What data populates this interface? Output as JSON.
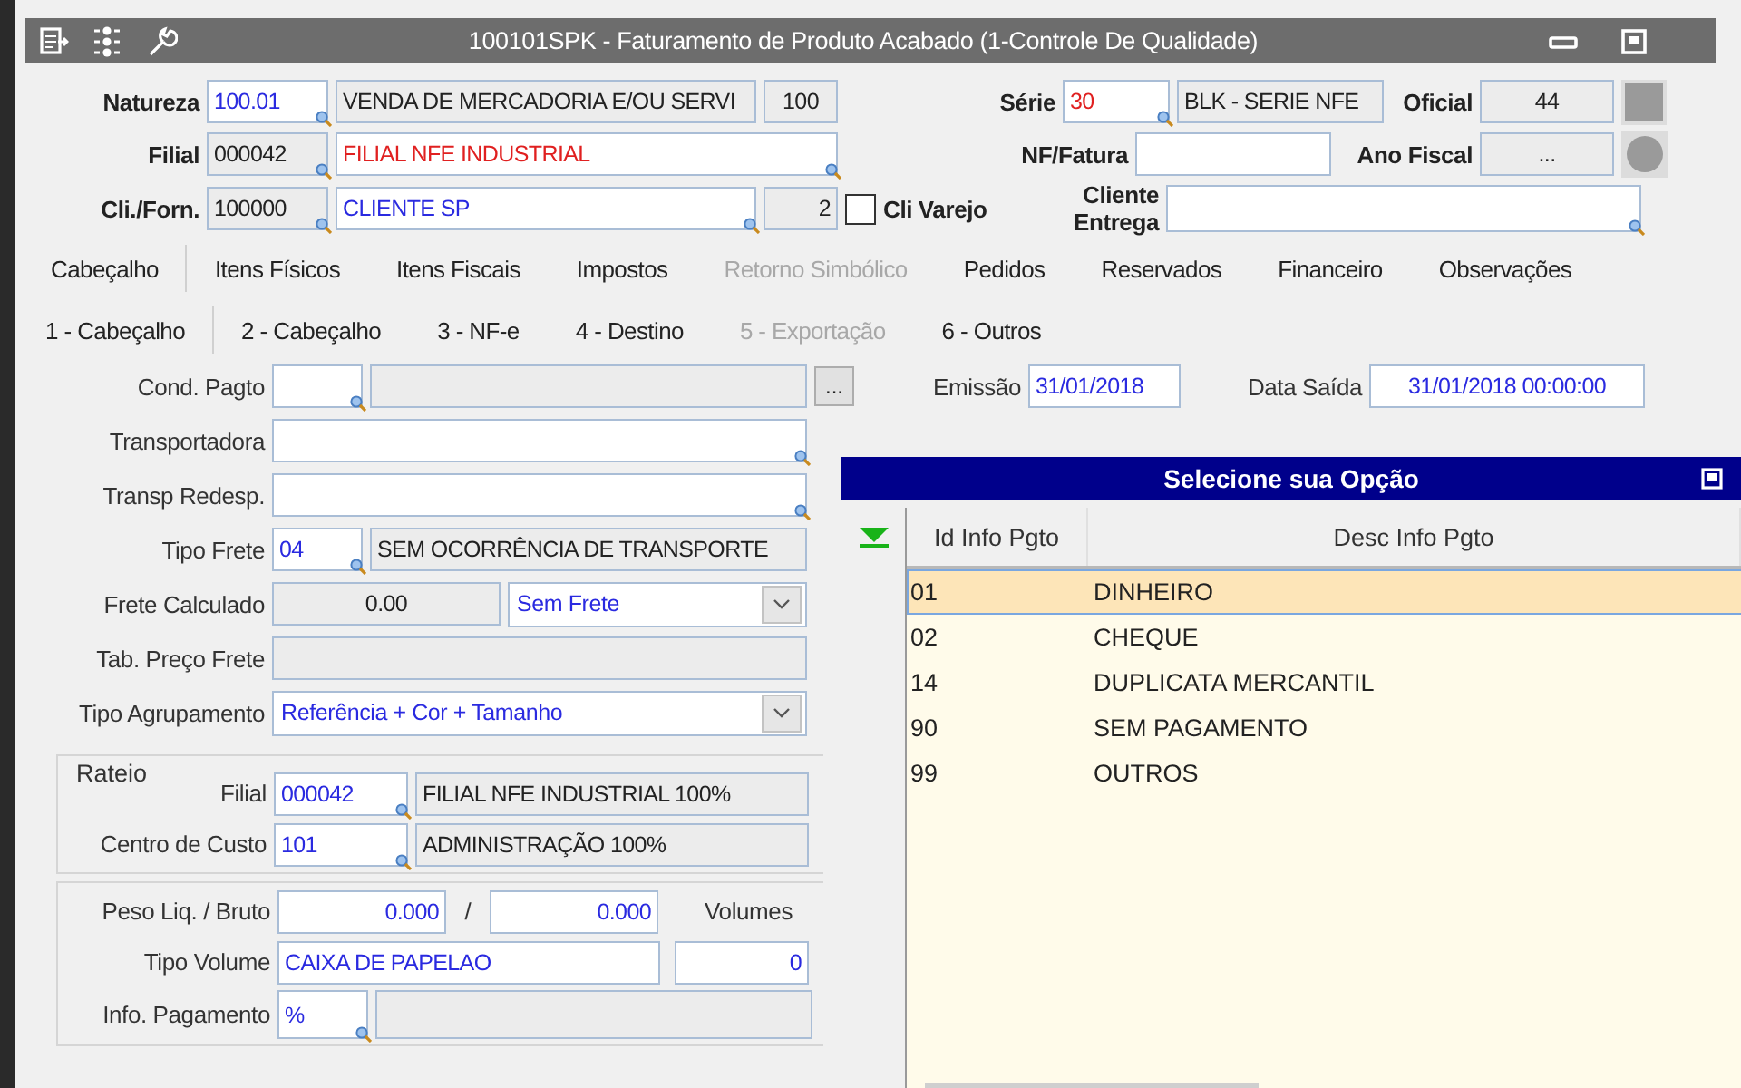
{
  "window": {
    "title": "100101SPK - Faturamento de Produto Acabado (1-Controle De Qualidade)"
  },
  "header": {
    "natureza": {
      "label": "Natureza",
      "code": {
        "value": "100.01",
        "readonly": false,
        "lookup": true
      },
      "description": {
        "value": "VENDA DE MERCADORIA E/OU SERVI",
        "readonly": true,
        "lookup": false
      },
      "number": {
        "value": "100",
        "readonly": true,
        "lookup": false
      }
    },
    "filial": {
      "label": "Filial",
      "code": {
        "value": "000042",
        "readonly": true,
        "lookup": true
      },
      "description": {
        "value": "FILIAL NFE INDUSTRIAL",
        "readonly": false,
        "lookup": true
      }
    },
    "cli_forn": {
      "label": "Cli./Forn.",
      "code": {
        "value": "100000",
        "readonly": true,
        "lookup": true
      },
      "description": {
        "value": "CLIENTE SP",
        "readonly": false,
        "lookup": true
      },
      "number": {
        "value": "2",
        "readonly": true,
        "lookup": false
      }
    },
    "cli_varejo": {
      "label": "Cli Varejo",
      "checked": false
    },
    "serie": {
      "label": "Série",
      "code": {
        "value": "30",
        "readonly": false,
        "lookup": true
      },
      "description": {
        "value": "BLK - SERIE NFE",
        "readonly": true,
        "lookup": false
      }
    },
    "oficial": {
      "label": "Oficial",
      "field": {
        "value": "44",
        "readonly": true,
        "lookup": false
      }
    },
    "nf_fatura": {
      "label": "NF/Fatura",
      "field": {
        "readonly": false,
        "lookup": false
      }
    },
    "ano_fiscal": {
      "label": "Ano Fiscal",
      "field": {
        "value": "...",
        "readonly": true,
        "lookup": false
      }
    },
    "cliente_entrega": {
      "label": "Cliente Entrega",
      "field": {
        "readonly": false,
        "lookup": true
      }
    }
  },
  "tabs": [
    {
      "label": "Cabeçalho",
      "selected": true,
      "disabled": false
    },
    {
      "label": "Itens Físicos",
      "selected": false,
      "disabled": false
    },
    {
      "label": "Itens Fiscais",
      "selected": false,
      "disabled": false
    },
    {
      "label": "Impostos",
      "selected": false,
      "disabled": false
    },
    {
      "label": "Retorno Simbólico",
      "selected": false,
      "disabled": true
    },
    {
      "label": "Pedidos",
      "selected": false,
      "disabled": false
    },
    {
      "label": "Reservados",
      "selected": false,
      "disabled": false
    },
    {
      "label": "Financeiro",
      "selected": false,
      "disabled": false
    },
    {
      "label": "Observações",
      "selected": false,
      "disabled": false
    }
  ],
  "subtabs": [
    {
      "label": "1 - Cabeçalho",
      "selected": true,
      "disabled": false
    },
    {
      "label": "2 - Cabeçalho",
      "selected": false,
      "disabled": false
    },
    {
      "label": "3 - NF-e",
      "selected": false,
      "disabled": false
    },
    {
      "label": "4 - Destino",
      "selected": false,
      "disabled": false
    },
    {
      "label": "5 - Exportação",
      "selected": false,
      "disabled": true
    },
    {
      "label": "6 - Outros",
      "selected": false,
      "disabled": false
    }
  ],
  "form": {
    "cond_pagto": {
      "label": "Cond. Pagto",
      "code": {
        "readonly": false,
        "lookup": true
      },
      "description": {
        "readonly": true,
        "lookup": false
      },
      "button": "..."
    },
    "emissao": {
      "label": "Emissão",
      "field": {
        "value": "31/01/2018",
        "readonly": false,
        "lookup": false
      }
    },
    "data_saida": {
      "label": "Data Saída",
      "field": {
        "value": "31/01/2018 00:00:00",
        "readonly": false,
        "lookup": false
      }
    },
    "transportadora": {
      "label": "Transportadora",
      "field": {
        "readonly": false,
        "lookup": true
      }
    },
    "transp_redesp": {
      "label": "Transp Redesp.",
      "field": {
        "readonly": false,
        "lookup": true
      }
    },
    "tipo_frete": {
      "label": "Tipo Frete",
      "code": {
        "value": "04",
        "readonly": false,
        "lookup": true
      },
      "description": {
        "value": "SEM OCORRÊNCIA DE TRANSPORTE",
        "readonly": true,
        "lookup": false
      }
    },
    "frete_calculado": {
      "label": "Frete Calculado",
      "field": {
        "value": "0.00",
        "readonly": true,
        "lookup": false
      },
      "select": "Sem Frete"
    },
    "tab_preco_frete": {
      "label": "Tab. Preço Frete",
      "field": {
        "readonly": true,
        "lookup": false
      }
    },
    "tipo_agrupamento": {
      "label": "Tipo Agrupamento",
      "select": "Referência + Cor + Tamanho"
    },
    "rateio": {
      "title": "Rateio",
      "filial": {
        "label": "Filial",
        "code": {
          "value": "000042",
          "readonly": false,
          "lookup": true
        },
        "description": {
          "value": "FILIAL NFE INDUSTRIAL  100%",
          "readonly": true,
          "lookup": false
        }
      },
      "centro_custo": {
        "label": "Centro de Custo",
        "code": {
          "value": "101",
          "readonly": false,
          "lookup": true
        },
        "description": {
          "value": "ADMINISTRAÇÃO 100%",
          "readonly": true,
          "lookup": false
        }
      }
    },
    "peso": {
      "label": "Peso Liq. / Bruto",
      "liquido": {
        "value": "0.000",
        "readonly": false,
        "lookup": false
      },
      "separator": "/",
      "bruto": {
        "value": "0.000",
        "readonly": false,
        "lookup": false
      },
      "volumes_label": "Volumes"
    },
    "tipo_volume": {
      "label": "Tipo Volume",
      "field": {
        "value": "CAIXA DE PAPELAO",
        "readonly": false,
        "lookup": false
      },
      "volumes": {
        "value": "0",
        "readonly": false,
        "lookup": false
      }
    },
    "info_pagamento": {
      "label": "Info. Pagamento",
      "code": {
        "value": "%",
        "readonly": false,
        "lookup": true
      },
      "description": {
        "readonly": true,
        "lookup": false
      }
    }
  },
  "popup": {
    "title": "Selecione sua Opção",
    "columns": [
      "Id Info Pgto",
      "Desc Info Pgto"
    ],
    "rows": [
      {
        "id": "01",
        "description": "DINHEIRO",
        "selected": true
      },
      {
        "id": "02",
        "description": "CHEQUE",
        "selected": false
      },
      {
        "id": "14",
        "description": "DUPLICATA MERCANTIL",
        "selected": false
      },
      {
        "id": "90",
        "description": "SEM PAGAMENTO",
        "selected": false
      },
      {
        "id": "99",
        "description": "OUTROS",
        "selected": false
      }
    ]
  }
}
